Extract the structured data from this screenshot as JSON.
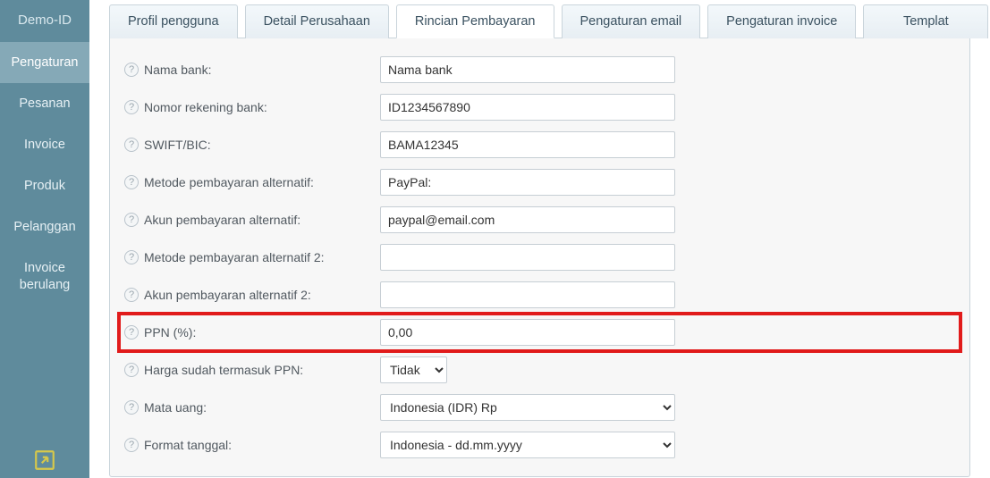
{
  "sidebar": {
    "items": [
      {
        "label": "Demo-ID",
        "active": false
      },
      {
        "label": "Pengaturan",
        "active": true
      },
      {
        "label": "Pesanan",
        "active": false
      },
      {
        "label": "Invoice",
        "active": false
      },
      {
        "label": "Produk",
        "active": false
      },
      {
        "label": "Pelanggan",
        "active": false
      },
      {
        "label": "Invoice berulang",
        "active": false
      }
    ]
  },
  "tabs": [
    {
      "label": "Profil pengguna",
      "active": false
    },
    {
      "label": "Detail Perusahaan",
      "active": false
    },
    {
      "label": "Rincian Pembayaran",
      "active": true
    },
    {
      "label": "Pengaturan email",
      "active": false
    },
    {
      "label": "Pengaturan invoice",
      "active": false
    },
    {
      "label": "Templat",
      "active": false
    }
  ],
  "fields": {
    "bank_name": {
      "label": "Nama bank:",
      "value": "Nama bank"
    },
    "account_no": {
      "label": "Nomor rekening bank:",
      "value": "ID1234567890"
    },
    "swift": {
      "label": "SWIFT/BIC:",
      "value": "BAMA12345"
    },
    "alt_method": {
      "label": "Metode pembayaran alternatif:",
      "value": "PayPal:"
    },
    "alt_account": {
      "label": "Akun pembayaran alternatif:",
      "value": "paypal@email.com"
    },
    "alt_method2": {
      "label": "Metode pembayaran alternatif 2:",
      "value": ""
    },
    "alt_account2": {
      "label": "Akun pembayaran alternatif 2:",
      "value": ""
    },
    "ppn": {
      "label": "PPN (%):",
      "value": "0,00"
    },
    "ppn_included": {
      "label": "Harga sudah termasuk PPN:",
      "value": "Tidak"
    },
    "currency": {
      "label": "Mata uang:",
      "value": "Indonesia (IDR) Rp"
    },
    "date_format": {
      "label": "Format tanggal:",
      "value": "Indonesia - dd.mm.yyyy"
    }
  }
}
